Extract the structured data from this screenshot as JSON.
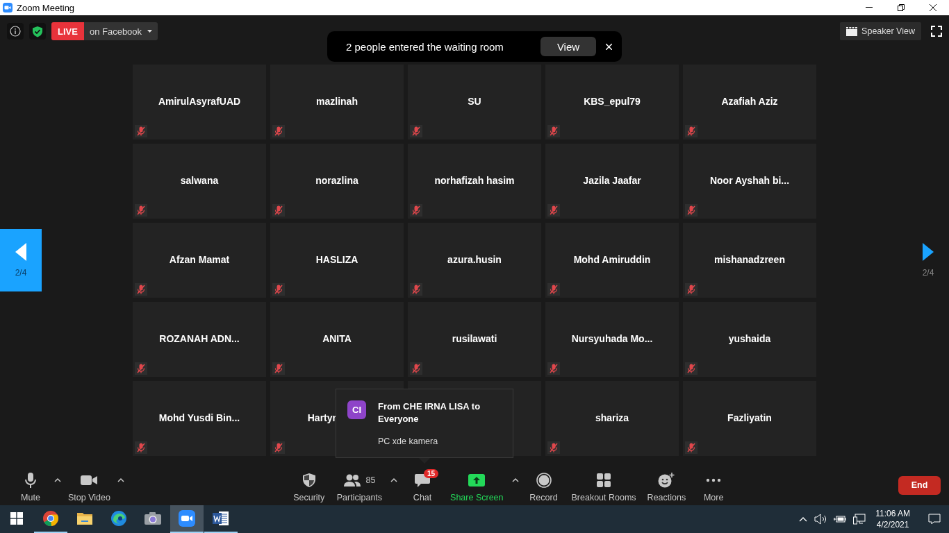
{
  "window": {
    "title": "Zoom Meeting"
  },
  "top_bar": {
    "live_label": "LIVE",
    "live_target": "on Facebook",
    "view_button": "Speaker View"
  },
  "notification": {
    "text": "2 people entered the waiting room",
    "action": "View"
  },
  "pager": {
    "left": "2/4",
    "right": "2/4"
  },
  "tiles": [
    {
      "name": "AmirulAsyrafUAD",
      "muted": true,
      "cut": false
    },
    {
      "name": "mazlinah",
      "muted": true,
      "cut": false
    },
    {
      "name": "SU",
      "muted": true,
      "cut": false
    },
    {
      "name": "KBS_epul79",
      "muted": true,
      "cut": false
    },
    {
      "name": "Azafiah Aziz",
      "muted": true,
      "cut": false
    },
    {
      "name": "salwana",
      "muted": true,
      "cut": false
    },
    {
      "name": "norazlina",
      "muted": true,
      "cut": false
    },
    {
      "name": "norhafizah hasim",
      "muted": true,
      "cut": false
    },
    {
      "name": "Jazila Jaafar",
      "muted": true,
      "cut": false
    },
    {
      "name": "Noor Ayshah bi...",
      "muted": true,
      "cut": false
    },
    {
      "name": "Afzan Mamat",
      "muted": true,
      "cut": false
    },
    {
      "name": "HASLIZA",
      "muted": true,
      "cut": false
    },
    {
      "name": "azura.husin",
      "muted": true,
      "cut": false
    },
    {
      "name": "Mohd Amiruddin",
      "muted": true,
      "cut": false
    },
    {
      "name": "mishanadzreen",
      "muted": true,
      "cut": false
    },
    {
      "name": "ROZANAH ADN...",
      "muted": true,
      "cut": false
    },
    {
      "name": "ANITA",
      "muted": true,
      "cut": false
    },
    {
      "name": "rusilawati",
      "muted": true,
      "cut": false
    },
    {
      "name": "Nursyuhada Mo...",
      "muted": true,
      "cut": false
    },
    {
      "name": "yushaida",
      "muted": true,
      "cut": false
    },
    {
      "name": "Mohd Yusdi Bin...",
      "muted": true,
      "cut": false
    },
    {
      "name": "Hartyr",
      "muted": true,
      "cut": true
    },
    {
      "name": "shariza",
      "muted": true,
      "cut": false
    },
    {
      "name": "Fazliyatin",
      "muted": true,
      "cut": false
    }
  ],
  "chat_popup": {
    "avatar": "CI",
    "title": "From CHE IRNA LISA to Everyone",
    "message": "PC xde kamera"
  },
  "toolbar": {
    "left_items": [
      {
        "kind": "mic",
        "label": "Mute",
        "caret": true
      },
      {
        "kind": "video",
        "label": "Stop Video",
        "caret": true
      }
    ],
    "center_items": [
      {
        "kind": "security",
        "label": "Security"
      },
      {
        "kind": "participants",
        "label": "Participants",
        "count": "85",
        "caret": true
      },
      {
        "kind": "chat",
        "label": "Chat",
        "badge": "15"
      },
      {
        "kind": "share",
        "label": "Share Screen",
        "caret": true
      },
      {
        "kind": "record",
        "label": "Record"
      },
      {
        "kind": "breakout",
        "label": "Breakout Rooms"
      },
      {
        "kind": "reactions",
        "label": "Reactions"
      },
      {
        "kind": "more",
        "label": "More"
      }
    ],
    "end": "End"
  },
  "taskbar": {
    "apps": [
      {
        "kind": "start",
        "running": false,
        "selected": false
      },
      {
        "kind": "chrome",
        "running": true,
        "selected": false
      },
      {
        "kind": "folder",
        "running": false,
        "selected": false
      },
      {
        "kind": "edge",
        "running": false,
        "selected": false
      },
      {
        "kind": "camera",
        "running": false,
        "selected": false
      },
      {
        "kind": "zoom",
        "running": true,
        "selected": true
      },
      {
        "kind": "word",
        "running": true,
        "selected": false
      }
    ],
    "time": "11:06 AM",
    "date": "4/2/2021"
  }
}
